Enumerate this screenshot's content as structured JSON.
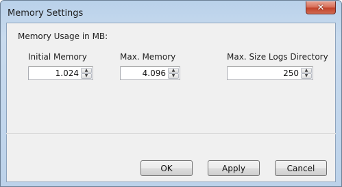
{
  "window": {
    "title": "Memory Settings",
    "close_glyph": "✕",
    "close_icon": "close-icon"
  },
  "settings": {
    "heading": "Memory Usage in MB:",
    "fields": [
      {
        "label": "Initial Memory",
        "value": "1.024"
      },
      {
        "label": "Max. Memory",
        "value": "4.096"
      },
      {
        "label": "Max. Size Logs Directory",
        "value": "250"
      }
    ],
    "spinner_up_glyph": "▲",
    "spinner_down_glyph": "▼"
  },
  "buttons": {
    "ok": "OK",
    "apply": "Apply",
    "cancel": "Cancel"
  }
}
